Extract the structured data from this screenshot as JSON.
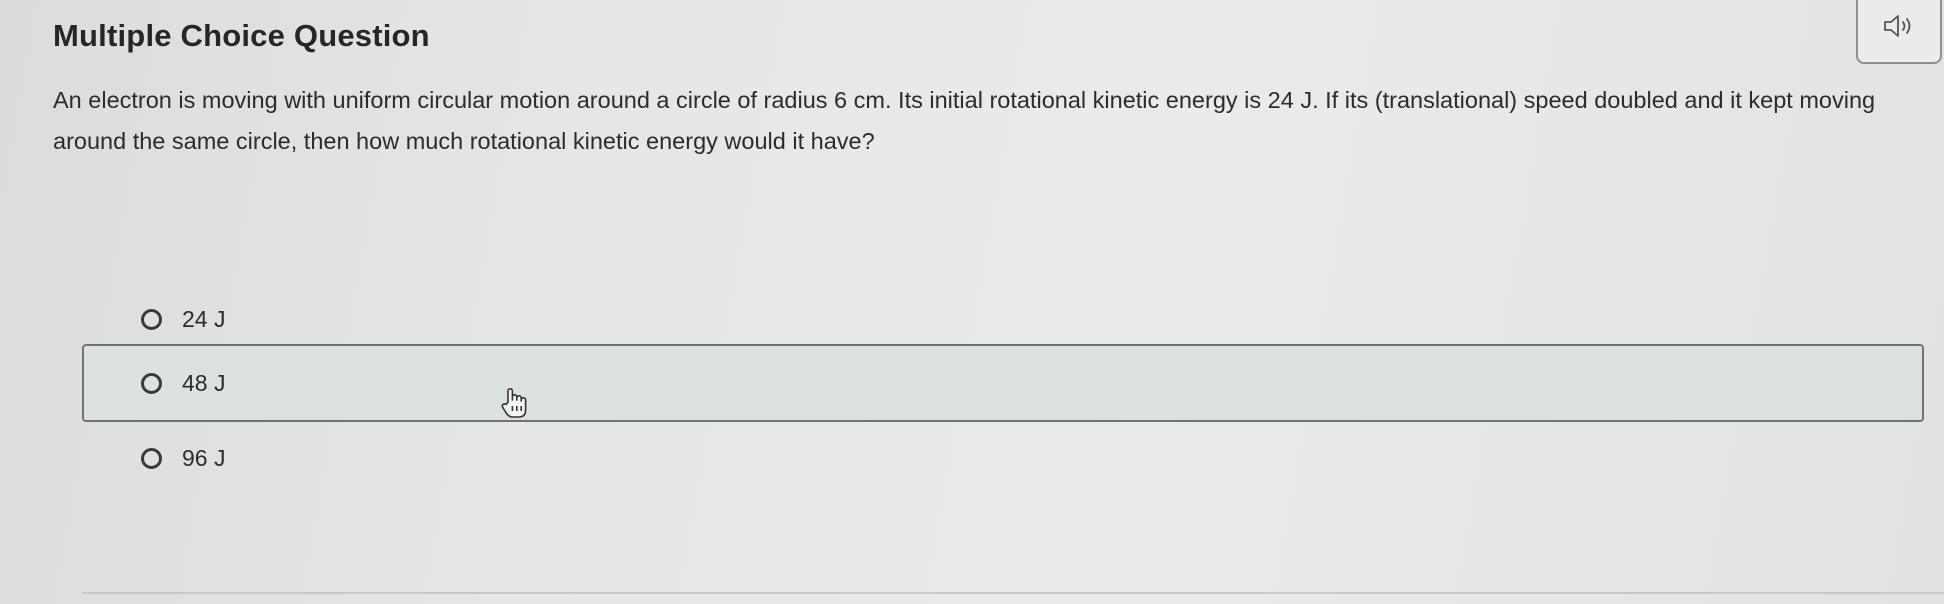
{
  "header": {
    "title": "Multiple Choice Question",
    "audio_icon": "speaker-icon"
  },
  "question": {
    "text": "An electron is moving with uniform circular motion around a circle of radius 6 cm. Its initial rotational kinetic energy is 24 J. If its (translational) speed doubled and it kept moving around the same circle, then how much rotational kinetic energy would it have?"
  },
  "options": [
    {
      "label": "24 J",
      "selected": false,
      "hovered": false
    },
    {
      "label": "48 J",
      "selected": false,
      "hovered": true
    },
    {
      "label": "96 J",
      "selected": false,
      "hovered": false
    }
  ],
  "colors": {
    "hover_background": "#dce2e0",
    "hover_border": "#6e7674",
    "text": "#2c2c2c"
  }
}
